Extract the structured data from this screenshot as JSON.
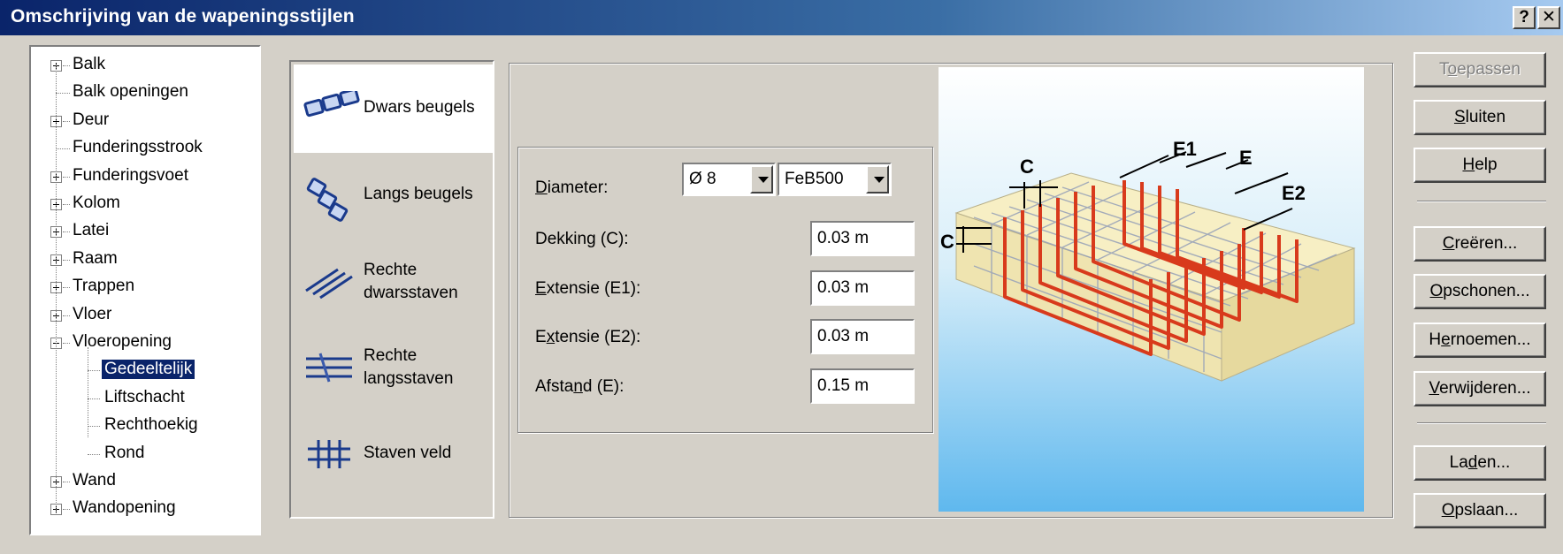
{
  "window": {
    "title": "Omschrijving van de wapeningsstijlen",
    "help_button": "?",
    "close_button": "✕"
  },
  "tree": {
    "items": [
      {
        "label": "Balk",
        "level": 0,
        "expander": "plus"
      },
      {
        "label": "Balk openingen",
        "level": 0,
        "expander": "none"
      },
      {
        "label": "Deur",
        "level": 0,
        "expander": "plus"
      },
      {
        "label": "Funderingsstrook",
        "level": 0,
        "expander": "none"
      },
      {
        "label": "Funderingsvoet",
        "level": 0,
        "expander": "plus"
      },
      {
        "label": "Kolom",
        "level": 0,
        "expander": "plus"
      },
      {
        "label": "Latei",
        "level": 0,
        "expander": "plus"
      },
      {
        "label": "Raam",
        "level": 0,
        "expander": "plus"
      },
      {
        "label": "Trappen",
        "level": 0,
        "expander": "plus"
      },
      {
        "label": "Vloer",
        "level": 0,
        "expander": "plus"
      },
      {
        "label": "Vloeropening",
        "level": 0,
        "expander": "minus"
      },
      {
        "label": "Gedeeltelijk",
        "level": 1,
        "expander": "none",
        "selected": true
      },
      {
        "label": "Liftschacht",
        "level": 1,
        "expander": "none"
      },
      {
        "label": "Rechthoekig",
        "level": 1,
        "expander": "none"
      },
      {
        "label": "Rond",
        "level": 1,
        "expander": "none"
      },
      {
        "label": "Wand",
        "level": 0,
        "expander": "plus"
      },
      {
        "label": "Wandopening",
        "level": 0,
        "expander": "plus"
      }
    ]
  },
  "tabs": [
    {
      "label_line1": "Dwars beugels",
      "label_line2": "",
      "icon": "dwars-beugels-icon",
      "active": true
    },
    {
      "label_line1": "Langs beugels",
      "label_line2": "",
      "icon": "langs-beugels-icon",
      "active": false
    },
    {
      "label_line1": "Rechte",
      "label_line2": "dwarsstaven",
      "icon": "rechte-dwarsstaven-icon",
      "active": false
    },
    {
      "label_line1": "Rechte",
      "label_line2": "langsstaven",
      "icon": "rechte-langsstaven-icon",
      "active": false
    },
    {
      "label_line1": "Staven veld",
      "label_line2": "",
      "icon": "staven-veld-icon",
      "active": false
    }
  ],
  "form": {
    "diameter": {
      "label_access": "D",
      "label_rest": "iameter:",
      "value": "Ø 8",
      "grade": "FeB500"
    },
    "dekking": {
      "label": "Dekking (C):",
      "value": "0.03 m"
    },
    "extensie1": {
      "label_access": "E",
      "label_rest": "xtensie (E1):",
      "value": "0.03 m"
    },
    "extensie2": {
      "label_pre": "E",
      "label_access": "x",
      "label_rest": "tensie (E2):",
      "value": "0.03 m"
    },
    "afstand": {
      "label_pre": "Afsta",
      "label_access": "n",
      "label_rest": "d (E):",
      "value": "0.15 m"
    }
  },
  "diagram": {
    "labels": {
      "c_top": "C",
      "c_side": "C",
      "e1": "E1",
      "e": "E",
      "e2": "E2"
    },
    "colors": {
      "sky_top": "#ffffff",
      "sky_bottom": "#6cc0f0",
      "slab": "#f5ecb8",
      "rebar": "#d83a1c",
      "grid": "#9aa4b8"
    }
  },
  "buttons": {
    "toepassen": {
      "pre": "T",
      "access": "o",
      "rest": "epassen",
      "disabled": true
    },
    "sluiten": {
      "pre": "",
      "access": "S",
      "rest": "luiten"
    },
    "help": {
      "pre": "",
      "access": "H",
      "rest": "elp"
    },
    "creeren": {
      "pre": "",
      "access": "C",
      "rest": "reëren..."
    },
    "opschonen": {
      "pre": "",
      "access": "O",
      "rest": "pschonen..."
    },
    "hernoemen": {
      "pre": "H",
      "access": "e",
      "rest": "rnoemen..."
    },
    "verwijderen": {
      "pre": "",
      "access": "V",
      "rest": "erwijderen..."
    },
    "laden": {
      "pre": "La",
      "access": "d",
      "rest": "en..."
    },
    "opslaan": {
      "pre": "",
      "access": "O",
      "rest": "pslaan..."
    }
  }
}
